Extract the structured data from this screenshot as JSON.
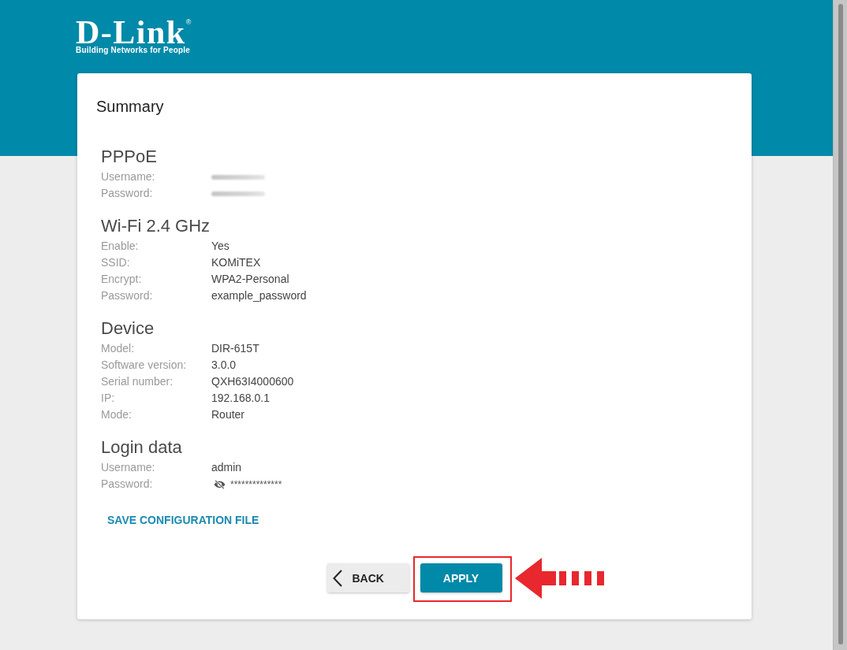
{
  "header": {
    "logo": "D-Link$^{®}$",
    "tagline": "Building Networks for People"
  },
  "card": {
    "title": "Summary",
    "sections": [
      {
        "title": "PPPoE",
        "rows": [
          {
            "label": "Username:",
            "kind": "blurred"
          },
          {
            "label": "Password:",
            "kind": "blurred"
          }
        ]
      },
      {
        "title": "Wi-Fi 2.4 GHz",
        "rows": [
          {
            "label": "Enable:",
            "kind": "text",
            "value": "Yes"
          },
          {
            "label": "SSID:",
            "kind": "text",
            "value": "KOMiTEX"
          },
          {
            "label": "Encrypt:",
            "kind": "text",
            "value": "WPA2-Personal"
          },
          {
            "label": "Password:",
            "kind": "text",
            "value": "example_password"
          }
        ]
      },
      {
        "title": "Device",
        "rows": [
          {
            "label": "Model:",
            "kind": "text",
            "value": "DIR-615T"
          },
          {
            "label": "Software version:",
            "kind": "text",
            "value": "3.0.0"
          },
          {
            "label": "Serial number:",
            "kind": "text",
            "value": "QXH63I4000600"
          },
          {
            "label": "IP:",
            "kind": "text",
            "value": "192.168.0.1"
          },
          {
            "label": "Mode:",
            "kind": "text",
            "value": "Router"
          }
        ]
      },
      {
        "title": "Login data",
        "rows": [
          {
            "label": "Username:",
            "kind": "text",
            "value": "admin"
          },
          {
            "label": "Password:",
            "kind": "masked",
            "value": "**************"
          }
        ]
      }
    ],
    "link": "SAVE CONFIGURATION FILE",
    "buttons": [
      {
        "label": "BACK",
        "kind": "back",
        "highlighted": false
      },
      {
        "label": "APPLY",
        "kind": "primary",
        "highlighted": true
      }
    ]
  }
}
